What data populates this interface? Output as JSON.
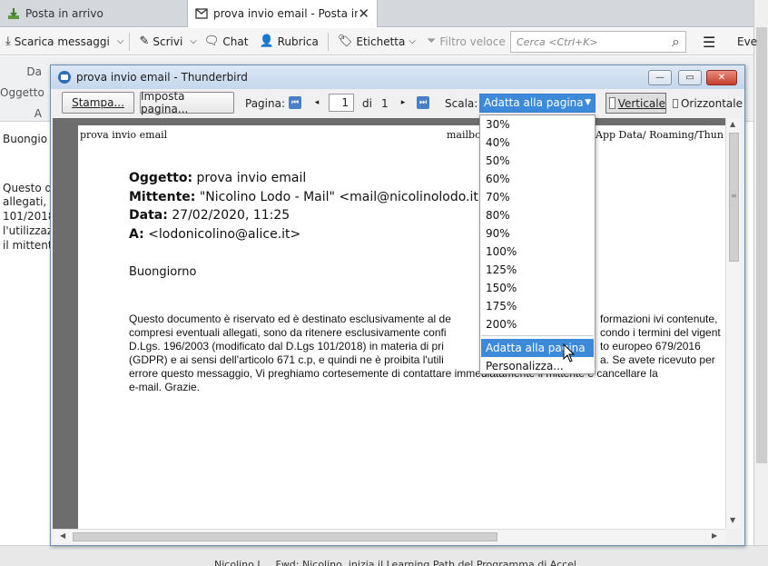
{
  "main": {
    "tabs": [
      {
        "label": "Posta in arrivo"
      },
      {
        "label": "prova invio email - Posta in"
      }
    ],
    "toolbar": {
      "get_messages": "Scarica messaggi",
      "write": "Scrivi",
      "chat": "Chat",
      "address_book": "Rubrica",
      "tag": "Etichetta",
      "quick_filter": "Filtro veloce",
      "search_placeholder": "Cerca <Ctrl+K>",
      "events": "Eve"
    },
    "header_labels": {
      "from": "Da",
      "subject": "Oggetto",
      "to": "A"
    },
    "body_lines": [
      "Buongio",
      "Questo d",
      "allegati, s",
      "101/2018",
      "l'utilizzaz",
      "il mittent"
    ],
    "status_text": "Nicolino L...   Fwd: Nicolino, inizia il Learning Path del Programma di Accel..."
  },
  "preview": {
    "window_title": "prova invio email - Thunderbird",
    "print_button": "Stampa...",
    "page_setup_button": "Imposta pagina...",
    "page_label": "Pagina:",
    "page_current": "1",
    "page_of": "di",
    "page_total": "1",
    "scale_label": "Scala:",
    "scale_value": "Adatta alla pagina",
    "portrait_label": "Verticale",
    "landscape_label": "Orizzontale",
    "page": {
      "header_left": "prova invio email",
      "header_right": "mailbo",
      "header_right2": "App Data/ Roaming/Thun",
      "subject_label": "Oggetto:",
      "subject_value": " prova invio email",
      "from_label": "Mittente:",
      "from_value": " \"Nicolino Lodo - Mail\" <mail@nicolinolodo.it>",
      "date_label": "Data:",
      "date_value": " 27/02/2020, 11:25",
      "to_label": "A:",
      "to_value": " <lodonicolino@alice.it>",
      "greeting": "Buongiorno",
      "body": [
        "Questo documento è riservato ed è destinato esclusivamente al de",
        "compresi eventuali allegati, sono da ritenere esclusivamente confi",
        "D.Lgs. 196/2003 (modificato dal D.Lgs 101/2018) in materia di pri",
        "(GDPR) e ai sensi dell'articolo 671 c.p, e quindi ne è proibita l'utili",
        "errore questo messaggio, Vi preghiamo cortesemente di contattare immediatamente il mittente e cancellare la",
        "e-mail. Grazie."
      ],
      "body_right": [
        "formazioni ivi contenute,",
        "condo i termini del vigent",
        "to europeo 679/2016",
        "a. Se avete ricevuto per",
        "",
        ""
      ]
    },
    "scale_options": [
      "30%",
      "40%",
      "50%",
      "60%",
      "70%",
      "80%",
      "90%",
      "100%",
      "125%",
      "150%",
      "175%",
      "200%"
    ],
    "scale_fit": "Adatta alla pagina",
    "scale_custom": "Personalizza..."
  }
}
